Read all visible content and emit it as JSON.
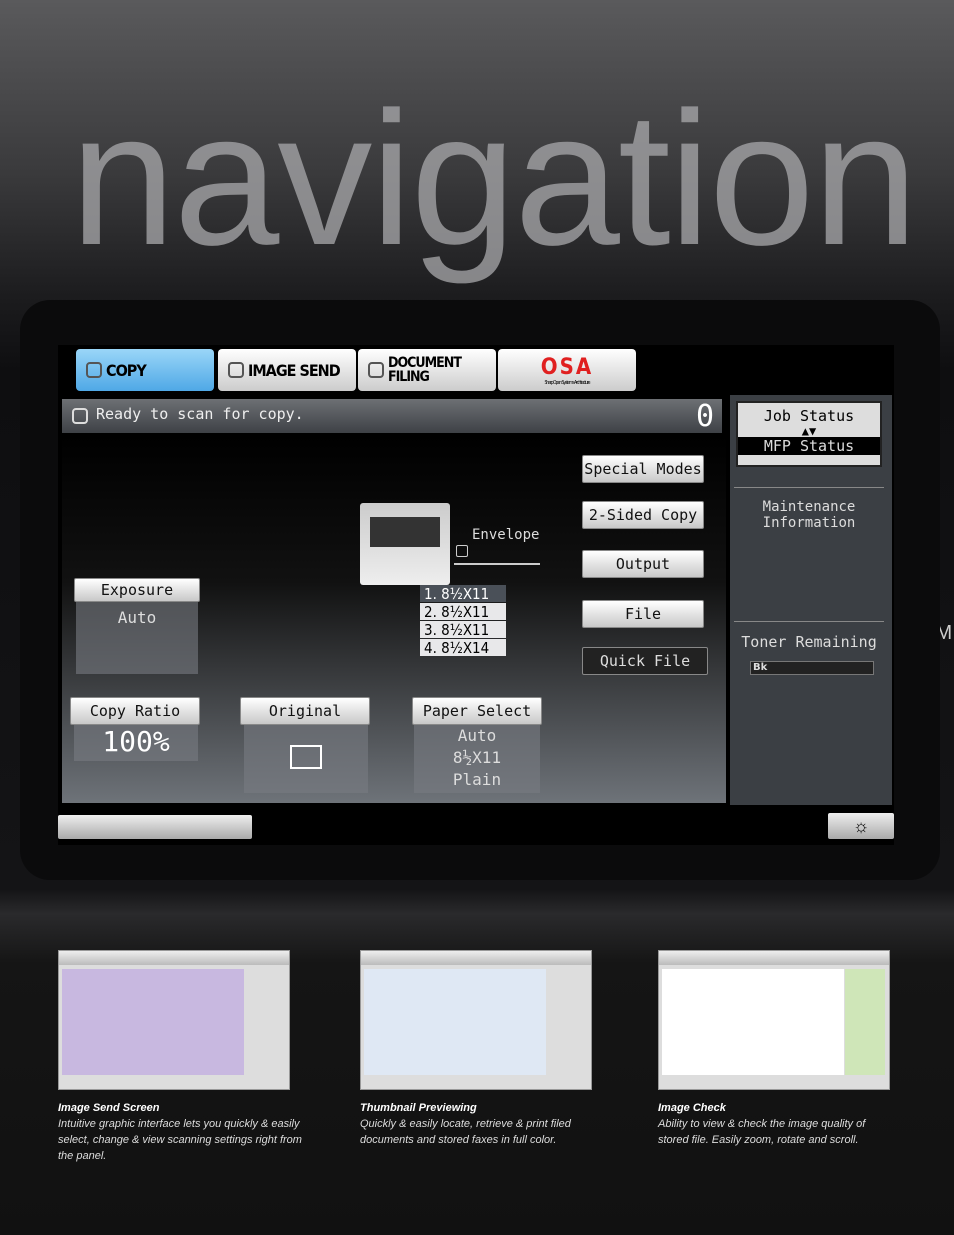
{
  "hero_title": "navigation",
  "side_text": "IM",
  "tabs": [
    {
      "label": "COPY",
      "active": true
    },
    {
      "label": "IMAGE SEND"
    },
    {
      "label": "DOCUMENT FILING"
    },
    {
      "label": "OSA",
      "sub": "Sharp Open Systems Architecture"
    }
  ],
  "status": {
    "message": "Ready to scan for copy.",
    "count": "0"
  },
  "right_panel": {
    "job_status": "Job Status",
    "mfp_status": "MFP Status",
    "maintenance": "Maintenance Information",
    "toner": "Toner Remaining",
    "toner_label": "Bk"
  },
  "buttons": {
    "special_modes": "Special Modes",
    "two_sided": "2-Sided Copy",
    "output": "Output",
    "file": "File",
    "quick_file": "Quick File"
  },
  "bypass": "Envelope",
  "trays": [
    "1. 8½X11",
    "2. 8½X11",
    "3. 8½X11",
    "4. 8½X14"
  ],
  "exposure": {
    "label": "Exposure",
    "value": "Auto"
  },
  "copy_ratio": {
    "label": "Copy Ratio",
    "value": "100%"
  },
  "original": {
    "label": "Original"
  },
  "paper_select": {
    "label": "Paper Select",
    "line1": "Auto",
    "line2": "8½X11",
    "line3": "Plain"
  },
  "captions": [
    {
      "title": "Image Send Screen",
      "text": "Intuitive graphic interface lets you quickly & easily select, change & view scanning settings right from the panel."
    },
    {
      "title": "Thumbnail Previewing",
      "text": "Quickly & easily locate, retrieve & print filed documents and stored faxes in full color."
    },
    {
      "title": "Image Check",
      "text": "Ability to view & check the image quality of stored file. Easily zoom, rotate and scroll."
    }
  ],
  "colors": {
    "active_tab": "#4fa8e6",
    "osa_red": "#e02020"
  }
}
